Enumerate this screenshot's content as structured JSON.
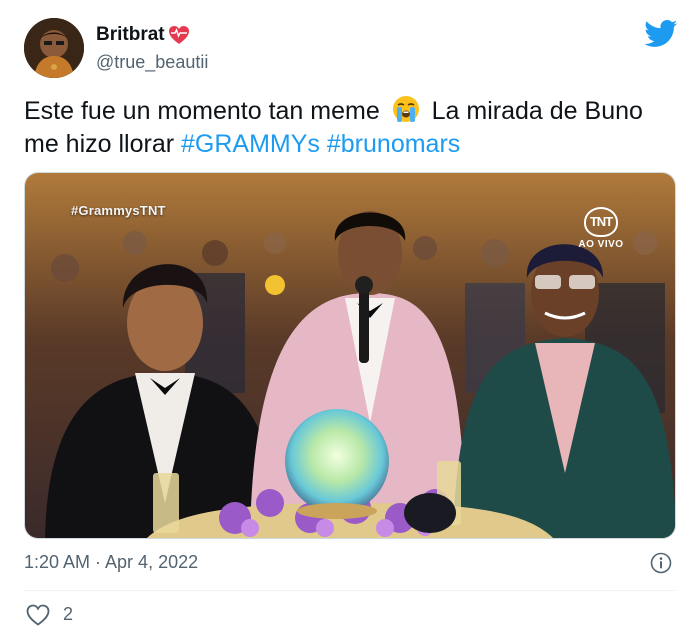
{
  "author": {
    "display_name": "Britbrat",
    "handle": "@true_beautii"
  },
  "tweet": {
    "text_part1": "Este fue un momento tan meme",
    "text_part2": "La mirada de Buno me hizo llorar",
    "hashtag1": "#GRAMMYs",
    "hashtag2": "#brunomars"
  },
  "media": {
    "overlay_tag": "#GrammysTNT",
    "tnt_logo": "TNT",
    "tnt_live": "AO VIVO"
  },
  "footer": {
    "timestamp": "1:20 AM · Apr 4, 2022",
    "like_count": "2"
  },
  "icons": {
    "brand": "twitter-bird-icon",
    "heart_emoji": "red-heart-icon",
    "cry_emoji": "loudly-crying-face-icon",
    "info": "info-icon",
    "like": "heart-outline-icon"
  },
  "colors": {
    "link": "#1d9bf0",
    "secondary_text": "#536471",
    "primary_text": "#0f1419",
    "brand": "#1d9bf0"
  }
}
